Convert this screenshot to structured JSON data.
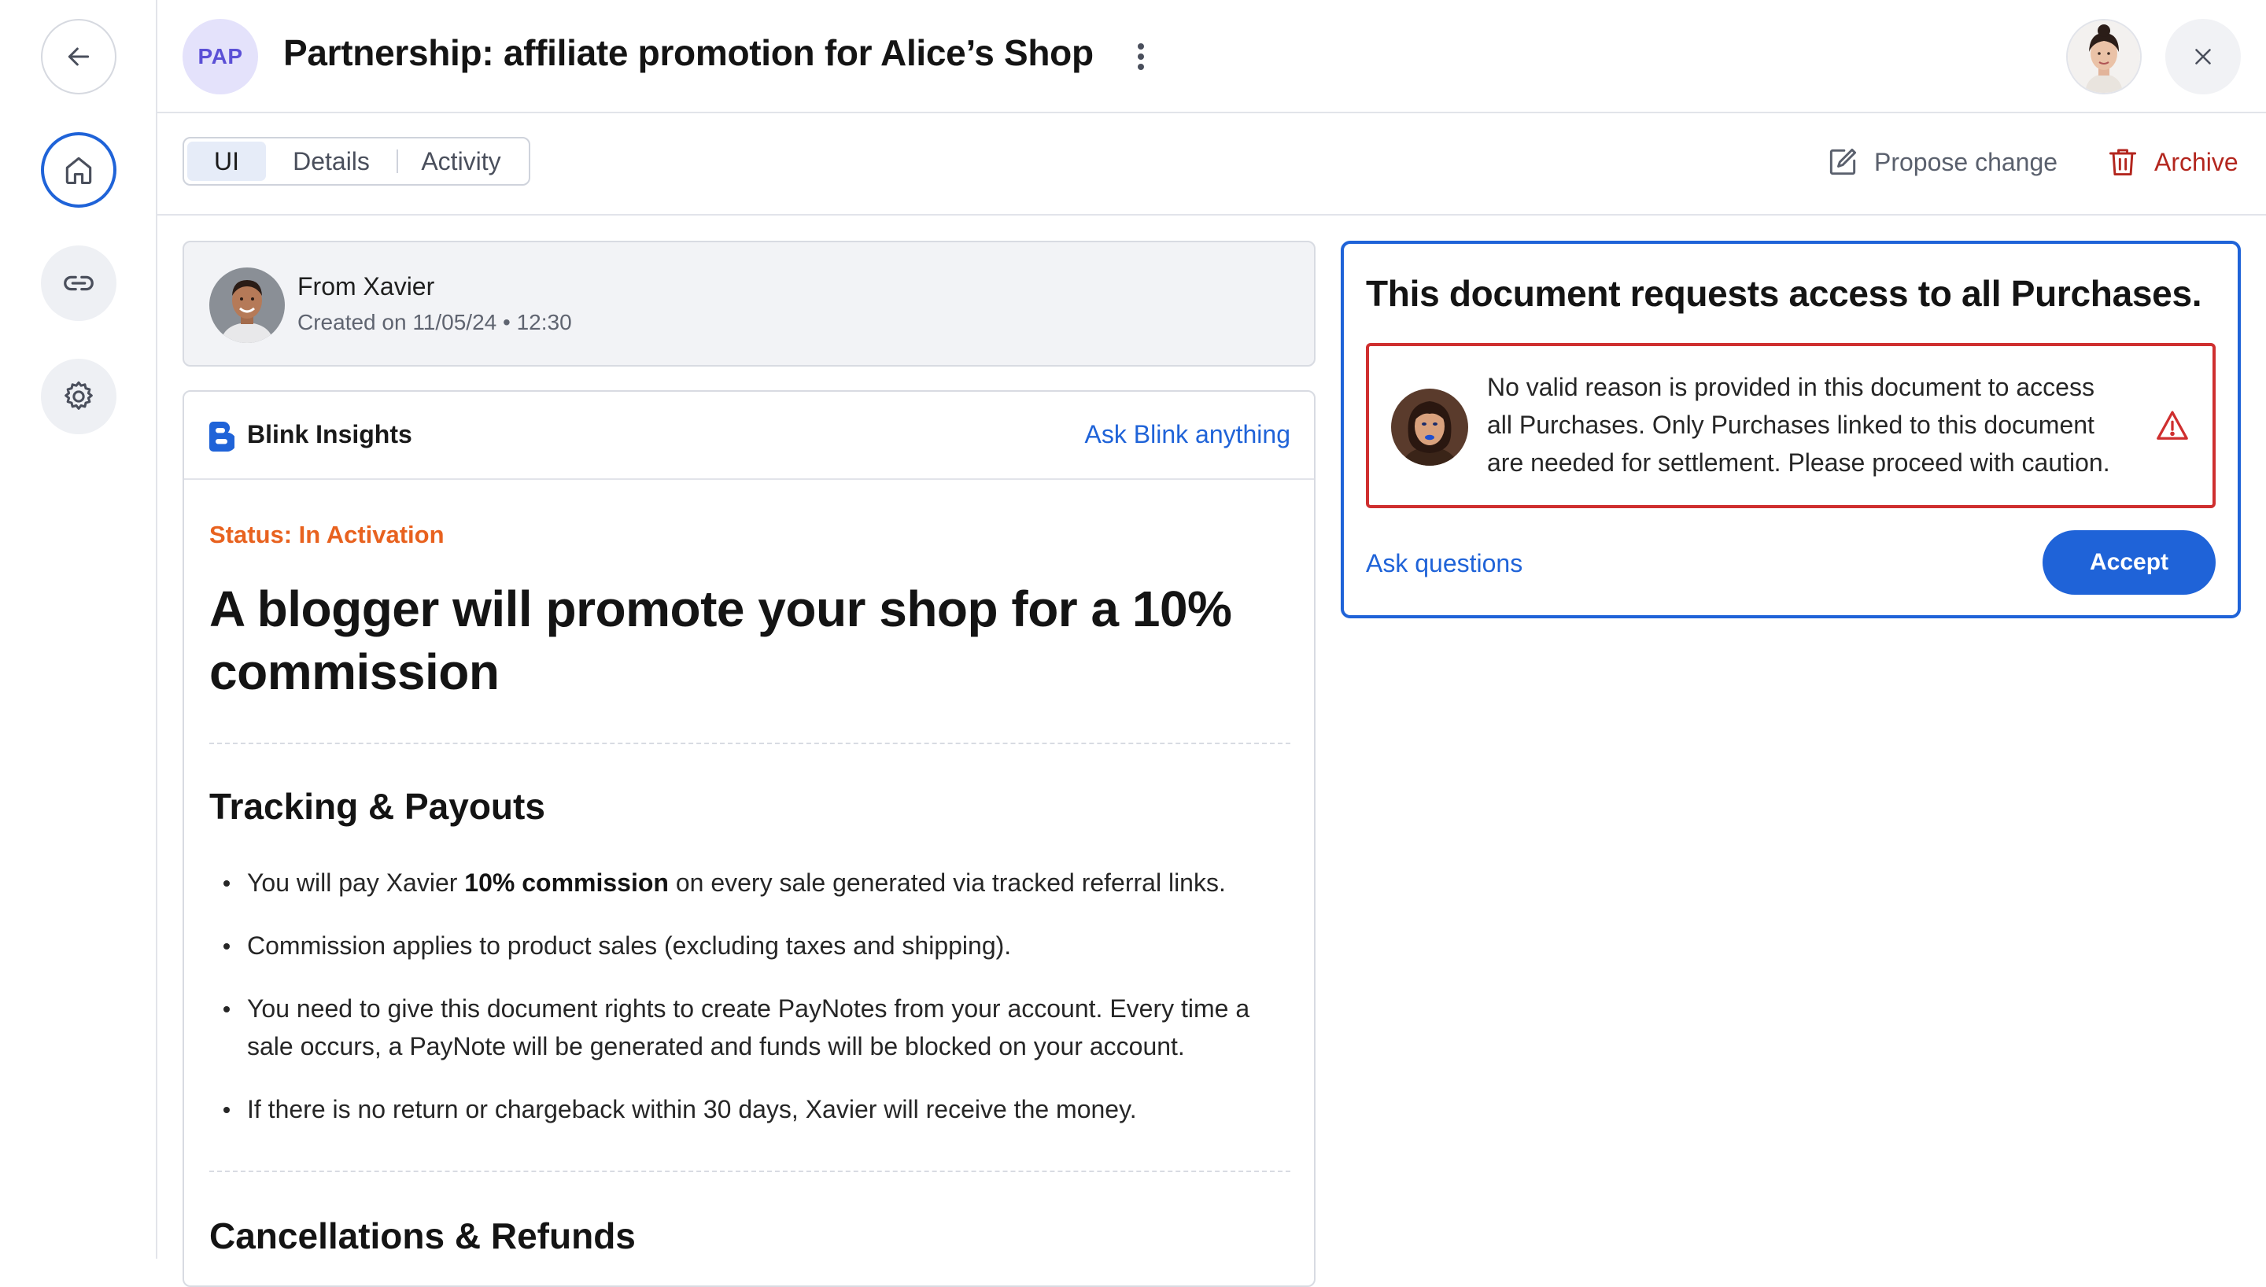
{
  "rail": {
    "items": [
      {
        "name": "back",
        "icon": "arrow-left-icon"
      },
      {
        "name": "home",
        "icon": "home-icon",
        "active": true
      },
      {
        "name": "links",
        "icon": "link-icon"
      },
      {
        "name": "settings",
        "icon": "gear-icon"
      }
    ]
  },
  "header": {
    "badge": "PAP",
    "title": "Partnership: affiliate promotion for Alice’s Shop",
    "menu_icon": "kebab-icon",
    "close_icon": "close-icon"
  },
  "toolbar": {
    "tabs": [
      {
        "label": "UI",
        "active": true
      },
      {
        "label": "Details",
        "active": false
      },
      {
        "label": "Activity",
        "active": false
      }
    ],
    "propose_label": "Propose change",
    "archive_label": "Archive"
  },
  "from_card": {
    "name": "From Xavier",
    "meta": "Created on 11/05/24 • 12:30"
  },
  "insights": {
    "brand": "Blink Insights",
    "ask_label": "Ask Blink anything",
    "status": "Status: In Activation",
    "headline": "A blogger will promote your shop for a 10% commission",
    "section1_title": "Tracking & Payouts",
    "bullets": [
      {
        "pre": "You will pay Xavier ",
        "bold": "10% commission",
        "post": " on every sale generated via tracked referral links."
      },
      {
        "pre": "Commission applies to product sales (excluding taxes and shipping).",
        "bold": "",
        "post": ""
      },
      {
        "pre": "You need to give this document rights to create PayNotes from your account. Every time a sale occurs, a PayNote will be generated and funds will be blocked on your account.",
        "bold": "",
        "post": ""
      },
      {
        "pre": "If there is no return or chargeback within 30 days, Xavier will receive the money.",
        "bold": "",
        "post": ""
      }
    ],
    "section2_title": "Cancellations & Refunds"
  },
  "access_request": {
    "title": "This document requests access to all Purchases.",
    "warning": "No valid reason is provided in this document to access all Purchases. Only Purchases linked to this document are needed for settlement. Please proceed with caution.",
    "ask_label": "Ask questions",
    "accept_label": "Accept"
  },
  "colors": {
    "accent": "#1f63d8",
    "danger": "#cf2f2f",
    "status": "#e8621f",
    "badge_bg": "#e4e2fb"
  }
}
